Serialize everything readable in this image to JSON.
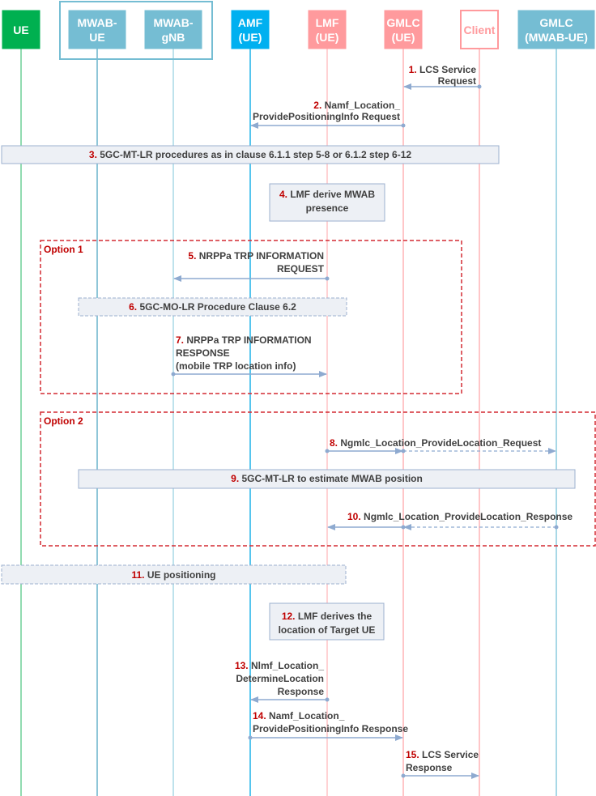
{
  "colors": {
    "ue": "#00b050",
    "mwab": "#75bdd3",
    "amf": "#00b0f0",
    "lmf": "#ff9a9d",
    "client_border": "#ff9a9d",
    "client_text": "#ff9a9d",
    "arrow": "#8eaad0",
    "box_fill": "#edf0f5",
    "box_border": "#9cb0cf",
    "option_border": "#d42a32",
    "step_number": "#c00000"
  },
  "entities": [
    {
      "id": "ue",
      "lines": [
        "UE"
      ]
    },
    {
      "id": "mwab-ue",
      "lines": [
        "MWAB-",
        "UE"
      ]
    },
    {
      "id": "mwab-gnb",
      "lines": [
        "MWAB-",
        "gNB"
      ]
    },
    {
      "id": "amf",
      "lines": [
        "AMF",
        "(UE)"
      ]
    },
    {
      "id": "lmf",
      "lines": [
        "LMF",
        "(UE)"
      ]
    },
    {
      "id": "gmlc-ue",
      "lines": [
        "GMLC",
        "(UE)"
      ]
    },
    {
      "id": "client",
      "lines": [
        "Client"
      ]
    },
    {
      "id": "gmlc-mwab-ue",
      "lines": [
        "GMLC",
        "(MWAB-UE)"
      ]
    }
  ],
  "options": [
    {
      "label": "Option 1"
    },
    {
      "label": "Option 2"
    }
  ],
  "steps": [
    {
      "n": "1.",
      "type": "message",
      "from": "client",
      "to": "gmlc-ue",
      "lines": [
        "LCS Service",
        "Request"
      ]
    },
    {
      "n": "2.",
      "type": "message",
      "from": "gmlc-ue",
      "to": "amf",
      "lines": [
        "Namf_Location_",
        "ProvidePositioningInfo Request"
      ]
    },
    {
      "n": "3.",
      "type": "procedure",
      "lines": [
        "5GC-MT-LR procedures as in clause 6.1.1 step 5-8 or 6.1.2 step 6-12"
      ]
    },
    {
      "n": "4.",
      "type": "action",
      "lines": [
        "LMF derive MWAB",
        "presence"
      ]
    },
    {
      "n": "5.",
      "type": "message",
      "from": "lmf",
      "to": "mwab-gnb",
      "lines": [
        "NRPPa TRP INFORMATION",
        "REQUEST"
      ]
    },
    {
      "n": "6.",
      "type": "procedure",
      "lines": [
        "5GC-MO-LR Procedure Clause 6.2"
      ]
    },
    {
      "n": "7.",
      "type": "message",
      "from": "mwab-gnb",
      "to": "lmf",
      "lines": [
        "NRPPa TRP INFORMATION",
        "RESPONSE",
        "(mobile TRP location info)"
      ]
    },
    {
      "n": "8.",
      "type": "message",
      "from": "lmf",
      "to": "gmlc-mwab-ue",
      "lines": [
        "Ngmlc_Location_ProvideLocation_Request"
      ]
    },
    {
      "n": "9.",
      "type": "procedure",
      "lines": [
        "5GC-MT-LR to estimate MWAB position"
      ]
    },
    {
      "n": "10.",
      "type": "message",
      "from": "gmlc-mwab-ue",
      "to": "lmf",
      "lines": [
        "Ngmlc_Location_ProvideLocation_Response"
      ]
    },
    {
      "n": "11.",
      "type": "procedure",
      "lines": [
        "UE positioning"
      ]
    },
    {
      "n": "12.",
      "type": "action",
      "lines": [
        "LMF derives the",
        "location of Target UE"
      ]
    },
    {
      "n": "13.",
      "type": "message",
      "from": "lmf",
      "to": "amf",
      "lines": [
        "Nlmf_Location_",
        "DetermineLocation",
        "Response"
      ]
    },
    {
      "n": "14.",
      "type": "message",
      "from": "amf",
      "to": "gmlc-ue",
      "lines": [
        "Namf_Location_",
        "ProvidePositioningInfo Response"
      ]
    },
    {
      "n": "15.",
      "type": "message",
      "from": "gmlc-ue",
      "to": "client",
      "lines": [
        "LCS Service",
        "Response"
      ]
    }
  ]
}
